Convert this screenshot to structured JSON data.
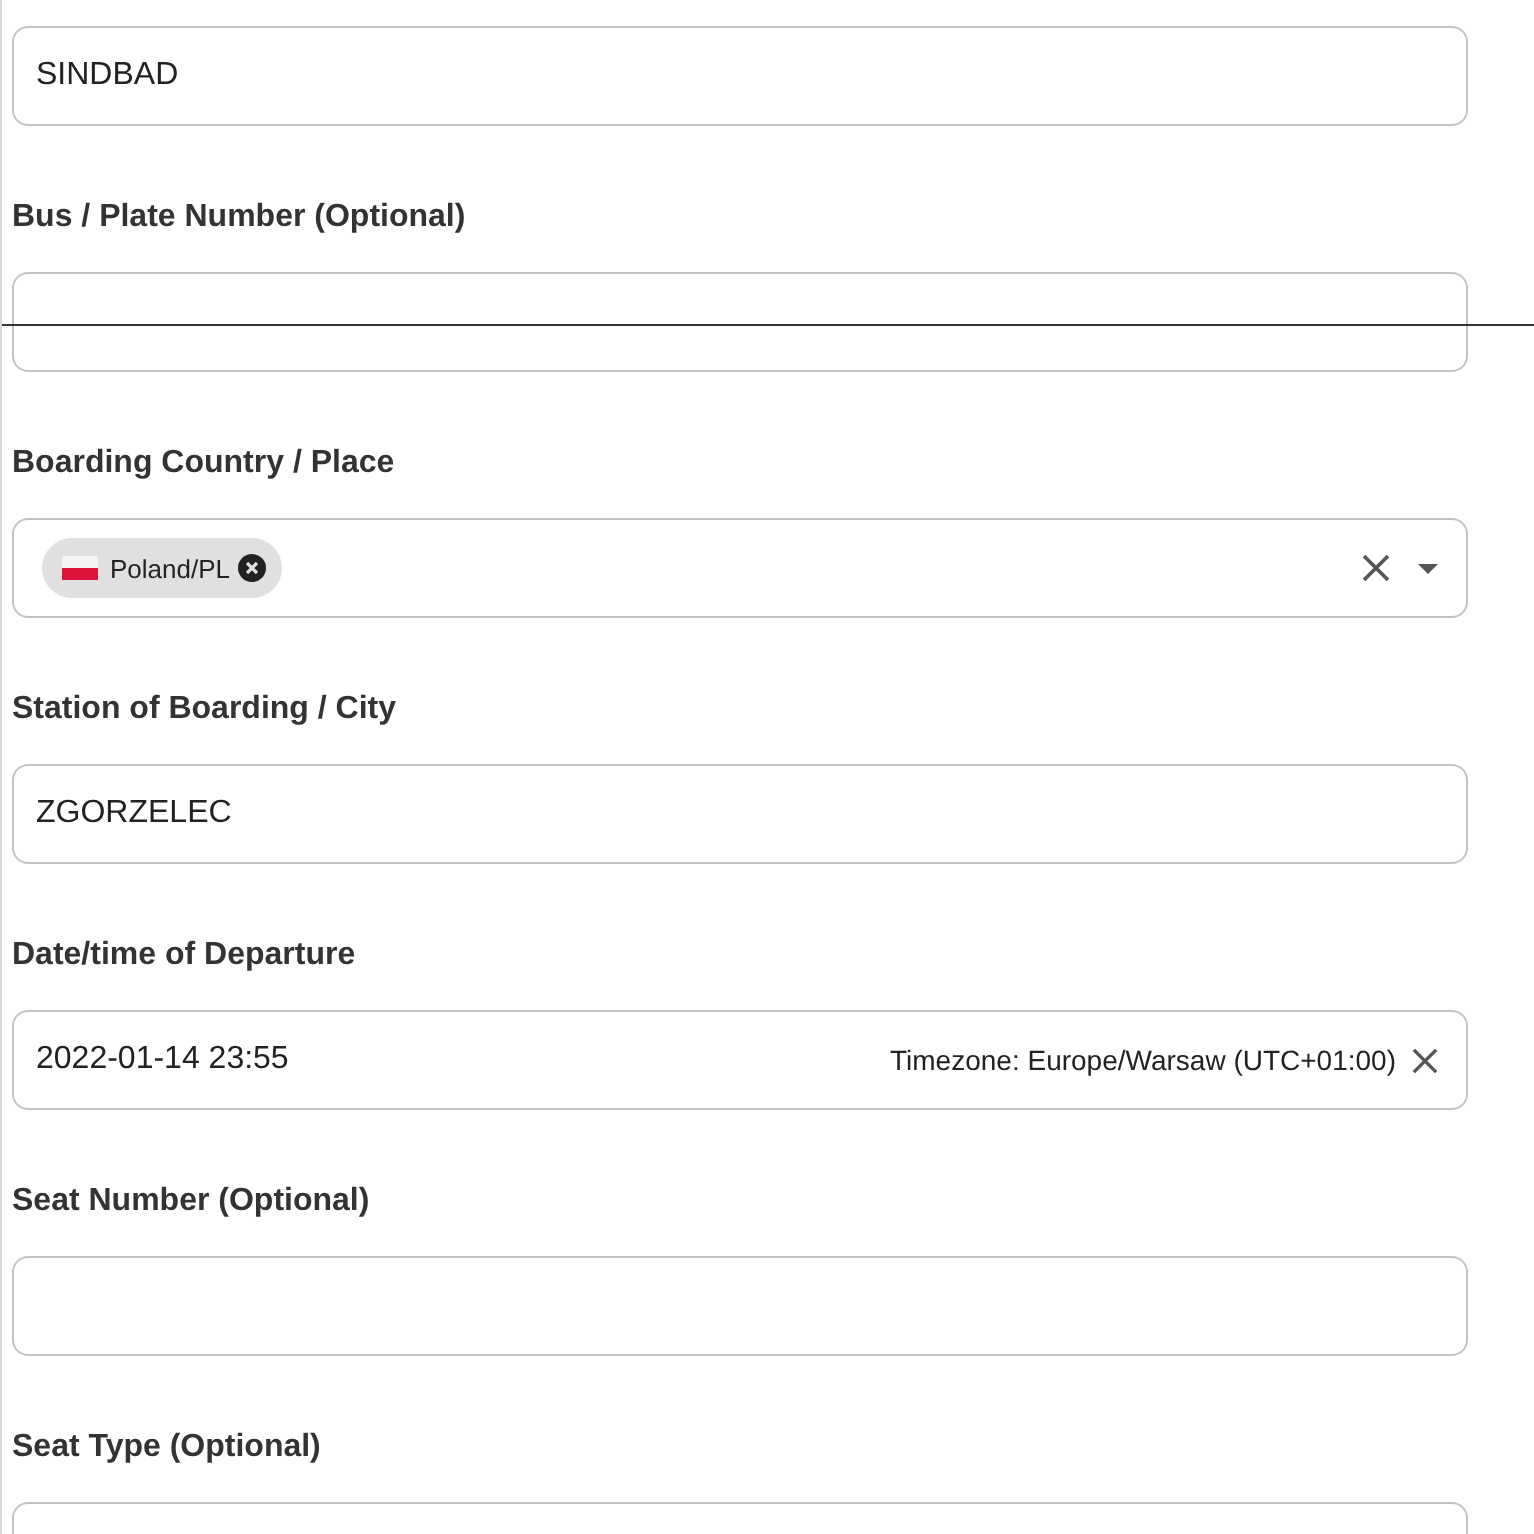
{
  "fields": [
    {
      "kind": "text",
      "value": "SINDBAD"
    },
    {
      "kind": "text",
      "label": "Bus / Plate Number (Optional)"
    },
    {
      "kind": "select",
      "label": "Boarding Country / Place",
      "chips": [
        {
          "label": "Poland/PL"
        }
      ]
    },
    {
      "kind": "text",
      "label": "Station of Boarding / City",
      "value": "ZGORZELEC"
    },
    {
      "kind": "datetime",
      "label": "Date/time of Departure",
      "value": "2022-01-14 23:55",
      "timezone": "Timezone: Europe/Warsaw (UTC+01:00)"
    },
    {
      "kind": "text",
      "label": "Seat Number (Optional)"
    },
    {
      "kind": "text",
      "label": "Seat Type (Optional)"
    }
  ]
}
